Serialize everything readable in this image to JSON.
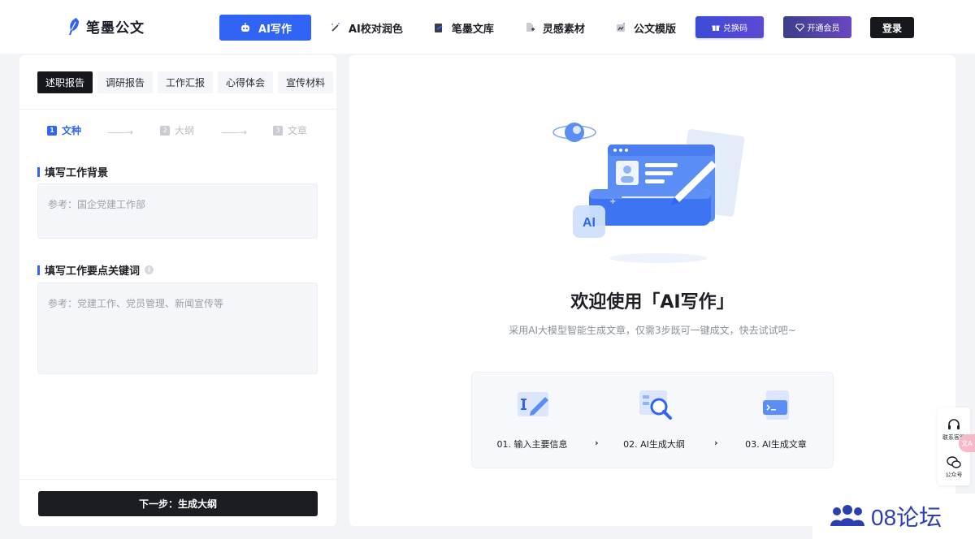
{
  "header": {
    "logo_text": "笔墨公文",
    "nav": [
      {
        "label": "AI写作",
        "icon": "robot-icon",
        "active": true
      },
      {
        "label": "AI校对润色",
        "icon": "magic-wand-icon",
        "active": false
      },
      {
        "label": "笔墨文库",
        "icon": "library-icon",
        "active": false
      },
      {
        "label": "灵感素材",
        "icon": "document-add-icon",
        "active": false
      },
      {
        "label": "公文模版",
        "icon": "template-icon",
        "active": false
      }
    ],
    "redeem_label": "兑换码",
    "vip_label": "开通会员",
    "login_label": "登录"
  },
  "left": {
    "types": [
      "述职报告",
      "调研报告",
      "工作汇报",
      "心得体会",
      "宣传材料"
    ],
    "active_type": "述职报告",
    "steps": [
      {
        "num": "1",
        "label": "文种"
      },
      {
        "num": "2",
        "label": "大纲"
      },
      {
        "num": "3",
        "label": "文章"
      }
    ],
    "step_arrow": "——→",
    "background_label": "填写工作背景",
    "background_placeholder": "参考：国企党建工作部",
    "keywords_label": "填写工作要点关键词",
    "keywords_placeholder": "参考：党建工作、党员管理、新闻宣传等",
    "info_glyph": "i",
    "next_button": "下一步：生成大纲"
  },
  "right": {
    "illus_badge": "AI",
    "welcome": "欢迎使用「AI写作」",
    "subtitle": "采用AI大模型智能生成文章，仅需3步既可一键成文，快去试试吧~",
    "steps": [
      "01. 输入主要信息",
      "02. AI生成大纲",
      "03. AI生成文章"
    ],
    "step_arrow": "›"
  },
  "side": {
    "service_label": "联系客服",
    "wechat_label": "公众号",
    "badge": "文A"
  },
  "watermark": "08论坛",
  "colors": {
    "accent": "#2f64f5",
    "dark": "#16181d"
  }
}
